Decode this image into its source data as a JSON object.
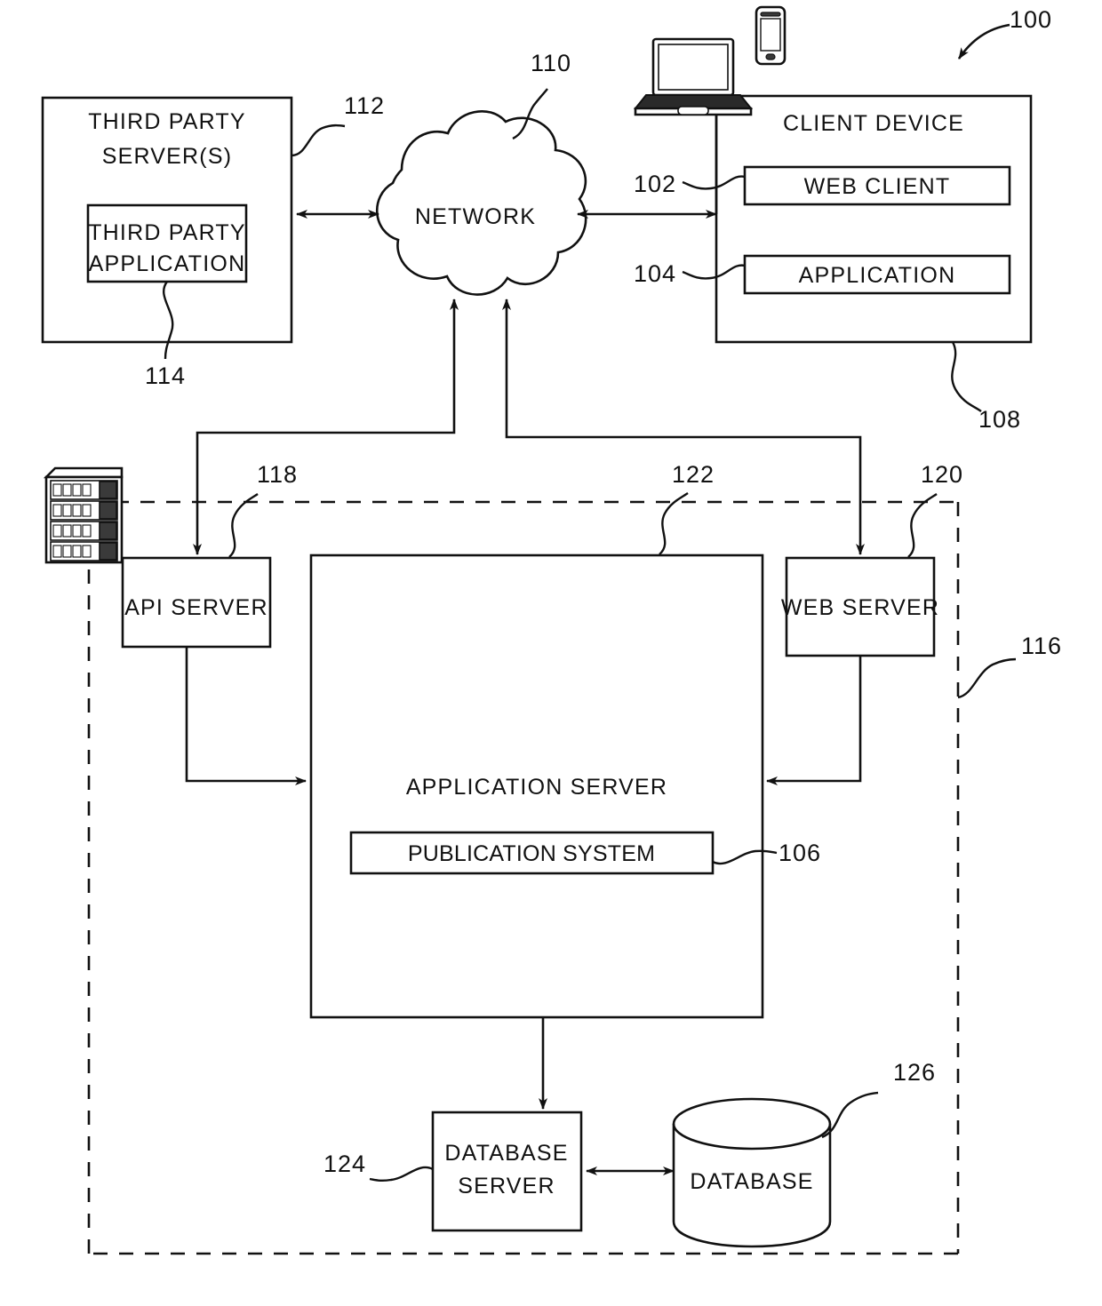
{
  "figure": {
    "title": "System architecture block diagram",
    "overall_ref": "100"
  },
  "nodes": {
    "third_party_server": {
      "label_line1": "THIRD PARTY",
      "label_line2": "SERVER(S)",
      "ref": "112"
    },
    "third_party_application": {
      "label_line1": "THIRD PARTY",
      "label_line2": "APPLICATION",
      "ref": "114"
    },
    "network": {
      "label": "NETWORK",
      "ref": "110"
    },
    "client_device": {
      "label": "CLIENT DEVICE",
      "ref": "108"
    },
    "web_client": {
      "label": "WEB CLIENT",
      "ref": "102"
    },
    "client_application": {
      "label": "APPLICATION",
      "ref": "104"
    },
    "api_server": {
      "label": "API SERVER",
      "ref": "118"
    },
    "web_server": {
      "label": "WEB SERVER",
      "ref": "120"
    },
    "application_server": {
      "label": "APPLICATION SERVER",
      "ref": "122"
    },
    "publication_system": {
      "label": "PUBLICATION SYSTEM",
      "ref": "106"
    },
    "database_server": {
      "label_line1": "DATABASE",
      "label_line2": "SERVER",
      "ref": "124"
    },
    "database": {
      "label": "DATABASE",
      "ref": "126"
    },
    "networked_system": {
      "ref": "116"
    }
  },
  "icons": {
    "laptop": "laptop-icon",
    "smartphone": "smartphone-icon",
    "server_rack": "server-rack-icon",
    "cloud": "cloud-icon",
    "database_cylinder": "database-cylinder-icon"
  },
  "colors": {
    "ink": "#111111",
    "background": "#ffffff"
  }
}
